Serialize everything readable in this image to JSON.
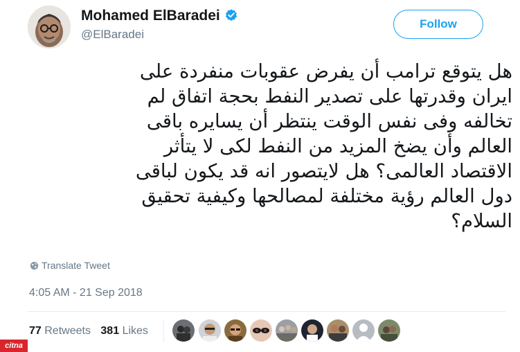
{
  "author": {
    "display_name": "Mohamed ElBaradei",
    "handle": "@ElBaradei",
    "verified": true,
    "verified_icon": "verified-badge-icon",
    "avatar_icon": "profile-photo"
  },
  "follow_button": {
    "label": "Follow"
  },
  "tweet": {
    "lines": [
      "هل يتوقع ترامب أن يفرض عقوبات منفردة على",
      "ايران وقدرتها على تصدير النفط بحجة اتفاق لم",
      "تخالفه وفى نفس الوقت ينتظر أن يسايره باقى",
      "العالم وأن يضخ المزيد من النفط لكى لا يتأثر",
      "الاقتصاد العالمى؟ هل لايتصور انه قد يكون لباقى",
      "دول العالم رؤية مختلفة لمصالحها وكيفية تحقيق",
      "السلام؟"
    ],
    "translate_label": "Translate Tweet",
    "timestamp": "4:05 AM - 21 Sep 2018"
  },
  "stats": {
    "retweets_count": "77",
    "retweets_label": "Retweets",
    "likes_count": "381",
    "likes_label": "Likes"
  },
  "liker_avatars": [
    "liker-avatar-1",
    "liker-avatar-2",
    "liker-avatar-3",
    "liker-avatar-4",
    "liker-avatar-5",
    "liker-avatar-6",
    "liker-avatar-7",
    "liker-avatar-8",
    "liker-avatar-9"
  ],
  "watermark": {
    "text": "citna"
  },
  "colors": {
    "accent": "#1da1f2",
    "text": "#14171a",
    "muted": "#657786",
    "divider": "#e6ecf0"
  }
}
